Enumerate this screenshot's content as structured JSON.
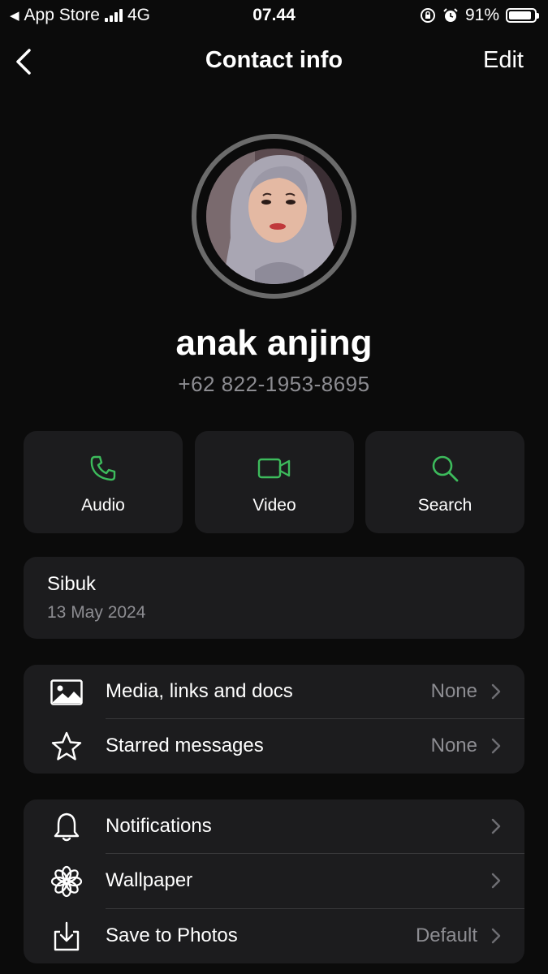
{
  "status_bar": {
    "back_app": "App Store",
    "network": "4G",
    "time": "07.44",
    "battery_percent": "91%",
    "battery_level": 0.91
  },
  "nav": {
    "title": "Contact info",
    "edit_label": "Edit"
  },
  "contact": {
    "name": "anak anjing",
    "phone": "+62 822-1953-8695"
  },
  "actions": [
    {
      "label": "Audio",
      "icon": "phone-icon"
    },
    {
      "label": "Video",
      "icon": "video-camera-icon"
    },
    {
      "label": "Search",
      "icon": "search-icon"
    }
  ],
  "about": {
    "text": "Sibuk",
    "date": "13 May 2024"
  },
  "media_section": [
    {
      "label": "Media, links and docs",
      "value": "None",
      "icon": "image-icon"
    },
    {
      "label": "Starred messages",
      "value": "None",
      "icon": "star-icon"
    }
  ],
  "settings_section": [
    {
      "label": "Notifications",
      "value": "",
      "icon": "bell-icon"
    },
    {
      "label": "Wallpaper",
      "value": "",
      "icon": "flower-icon"
    },
    {
      "label": "Save to Photos",
      "value": "Default",
      "icon": "download-icon"
    }
  ],
  "colors": {
    "background": "#0b0b0b",
    "card": "#1c1c1e",
    "accent_green": "#3dbb5c",
    "secondary_text": "#8d8d92"
  }
}
